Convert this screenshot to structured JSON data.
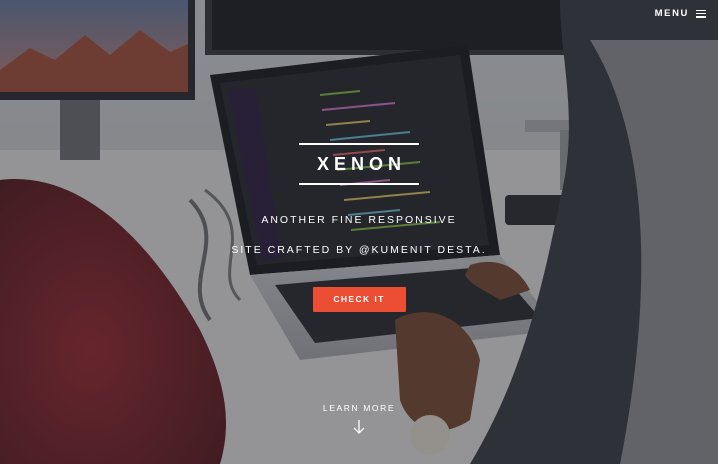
{
  "header": {
    "menu_label": "MENU",
    "menu_icon": "hamburger-icon"
  },
  "banner": {
    "title": "XENON",
    "tagline_line1": "ANOTHER FINE RESPONSIVE",
    "tagline_line2": "SITE CRAFTED BY @KUMENIT DESTA.",
    "cta_label": "CHECK IT"
  },
  "footer": {
    "learn_more_label": "LEARN MORE",
    "learn_more_icon": "arrow-down-icon"
  },
  "colors": {
    "accent": "#ec4e34",
    "overlay": "#1e1e24",
    "text": "#ffffff"
  }
}
